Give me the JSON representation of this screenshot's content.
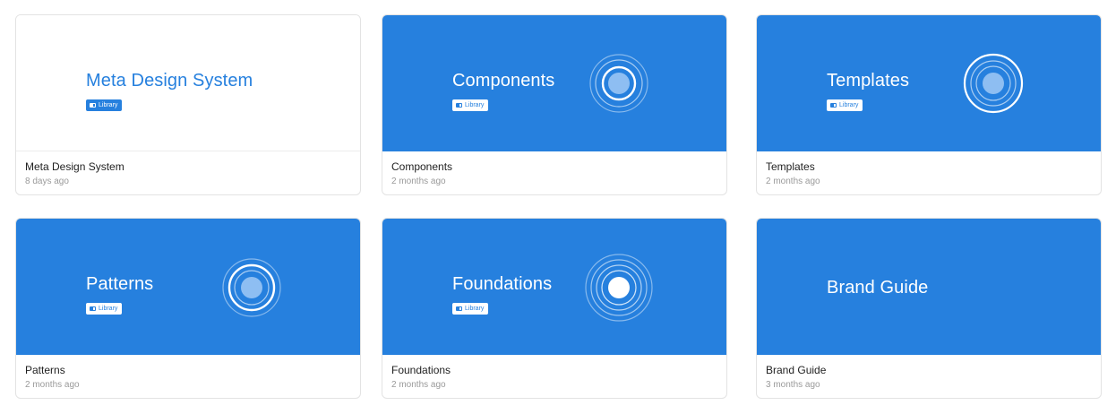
{
  "colors": {
    "accent": "#2680de",
    "card_border": "#e3e3e3",
    "muted_text": "#9a9a9a"
  },
  "cards": [
    {
      "thumb_title": "Meta Design System",
      "badge": "Library",
      "title": "Meta Design System",
      "subtitle": "8 days ago",
      "icon": "none"
    },
    {
      "thumb_title": "Components",
      "badge": "Library",
      "title": "Components",
      "subtitle": "2 months ago",
      "icon": "concentric-rings-icon"
    },
    {
      "thumb_title": "Templates",
      "badge": "Library",
      "title": "Templates",
      "subtitle": "2 months ago",
      "icon": "concentric-rings-icon"
    },
    {
      "thumb_title": "Patterns",
      "badge": "Library",
      "title": "Patterns",
      "subtitle": "2 months ago",
      "icon": "concentric-rings-icon"
    },
    {
      "thumb_title": "Foundations",
      "badge": "Library",
      "title": "Foundations",
      "subtitle": "2 months ago",
      "icon": "concentric-rings-icon"
    },
    {
      "thumb_title": "Brand Guide",
      "title": "Brand Guide",
      "subtitle": "3 months ago",
      "icon": "none"
    }
  ]
}
